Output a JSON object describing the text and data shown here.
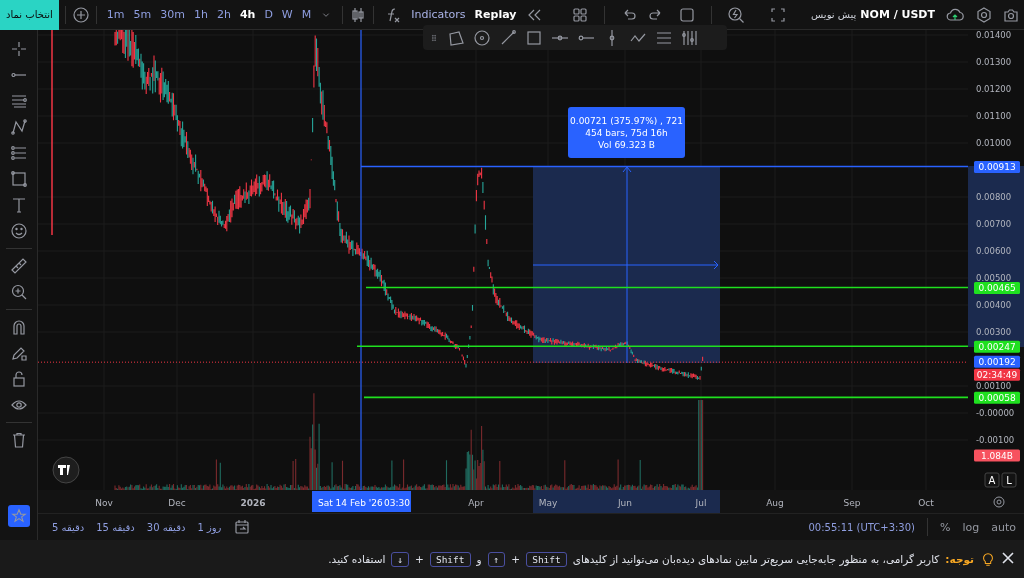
{
  "top_bar": {
    "symbol_button": "انتخاب نماد",
    "timeframes": [
      {
        "label": "1m",
        "selected": false
      },
      {
        "label": "5m",
        "selected": false
      },
      {
        "label": "30m",
        "selected": false
      },
      {
        "label": "1h",
        "selected": false
      },
      {
        "label": "2h",
        "selected": false
      },
      {
        "label": "4h",
        "selected": true
      },
      {
        "label": "D",
        "selected": false
      },
      {
        "label": "W",
        "selected": false
      },
      {
        "label": "M",
        "selected": false
      }
    ],
    "indicators": "Indicators",
    "replay": "Replay",
    "draft_label": "پیش نویس",
    "symbol": "NOM / USDT"
  },
  "chart": {
    "price_scale": [
      "0.01400",
      "0.01300",
      "0.01200",
      "0.01100",
      "0.01000",
      "0.00800",
      "0.00700",
      "0.00600",
      "0.00500",
      "0.00400",
      "0.00300",
      "0.00100",
      "-0.00000",
      "-0.00100"
    ],
    "price_tags": [
      {
        "kind": "price",
        "label": "0.00913",
        "color": "#2962ff"
      },
      {
        "kind": "price",
        "label": "0.00465",
        "color": "#1fe01f"
      },
      {
        "kind": "price",
        "label": "0.00247",
        "color": "#1fe01f"
      },
      {
        "kind": "price",
        "label": "0.00192",
        "color": "#2962ff"
      },
      {
        "kind": "countdown",
        "label": "02:34:49",
        "color": "#f23645"
      },
      {
        "kind": "price",
        "label": "0.00058",
        "color": "#1fe01f"
      },
      {
        "kind": "volume",
        "label": "1.084B",
        "color": "#f7525f"
      }
    ],
    "time_scale": [
      "Nov",
      "Dec",
      "2026",
      "Apr",
      "May",
      "Jun",
      "Jul",
      "Aug",
      "Sep",
      "Oct"
    ],
    "crosshair_time": {
      "date": "Sat 14 Feb '26",
      "time": "03:30"
    },
    "measure": {
      "lines": [
        "0.00721 (375.97%) , 721",
        "454 bars, 75d 16h",
        "Vol 69.323 B"
      ]
    },
    "scale_buttons": [
      "A",
      "L"
    ]
  },
  "bottom_bar": {
    "intervals": [
      "روز 1",
      "30 دقیقه",
      "15 دقیقه",
      "5 دقیقه"
    ],
    "clock": "00:55:11 (UTC+3:30)",
    "options": [
      "%",
      "log",
      "auto"
    ]
  },
  "notice": {
    "label": "توجه:",
    "message": "کاربر گرامی، به منظور جابه‌جایی سریع‌تر مابین نمادهای دیده‌بان می‌توانید از کلیدهای",
    "first_shortcut": {
      "modifier": "Shift",
      "plus": "+",
      "arrow": "↑"
    },
    "conjunction": "و",
    "second_shortcut": {
      "modifier": "Shift",
      "plus": "+",
      "arrow": "↓"
    },
    "ending": "استفاده کنید."
  }
}
